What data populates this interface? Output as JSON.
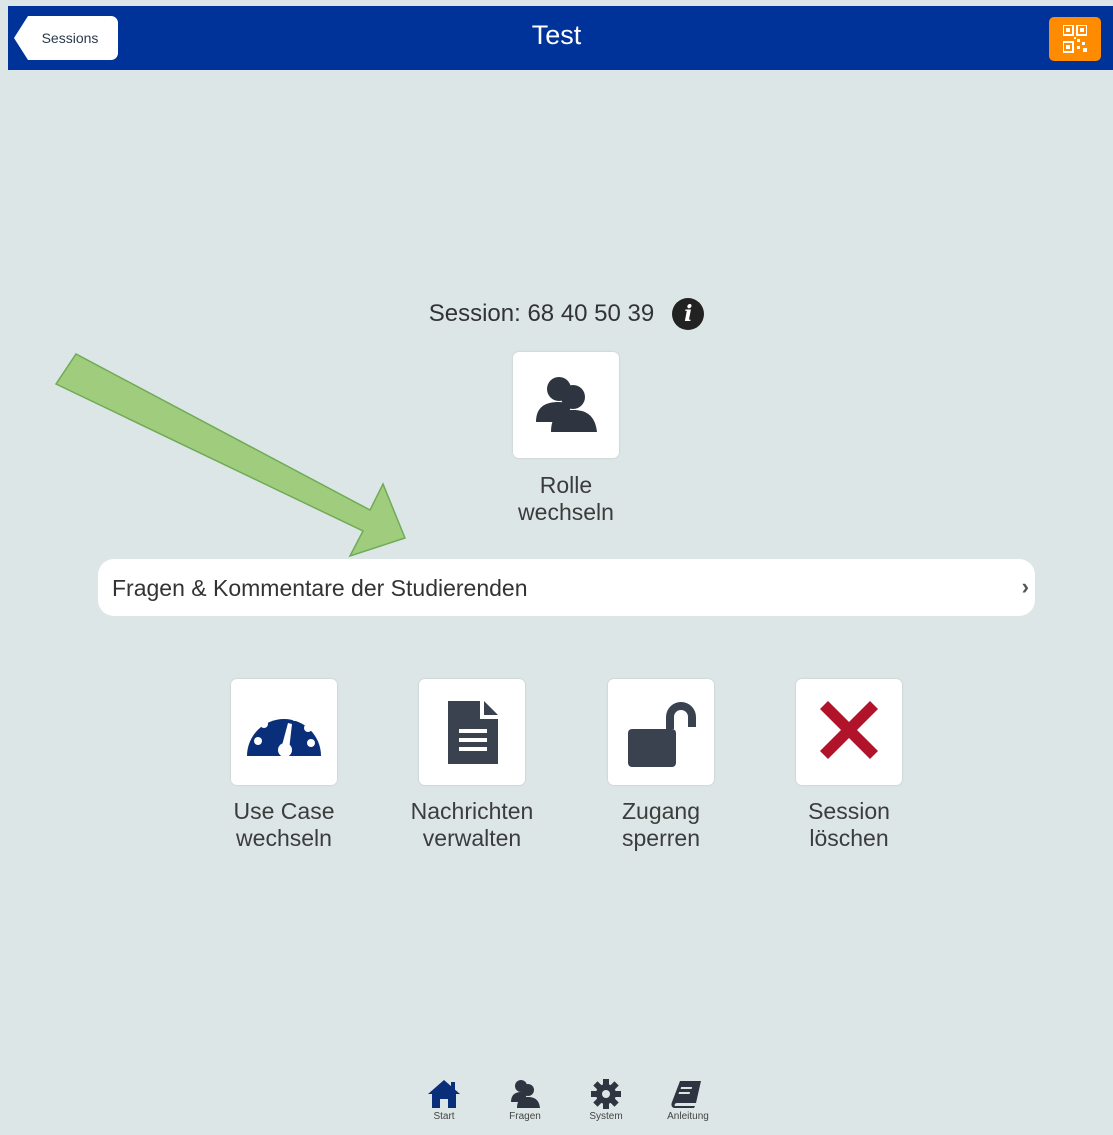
{
  "header": {
    "back_label": "Sessions",
    "title": "Test",
    "qr_icon": "qr-code-icon"
  },
  "session": {
    "text": "Session: 68 40 50 39",
    "info_icon": "info-icon"
  },
  "role_tile": {
    "icon": "users-icon",
    "label": "Rolle\nwechseln"
  },
  "questions_row": {
    "label": "Fragen & Kommentare der Studierenden",
    "chevron": "›"
  },
  "tiles": [
    {
      "icon": "dashboard-icon",
      "label": "Use Case\nwechseln"
    },
    {
      "icon": "document-icon",
      "label": "Nachrichten\nverwalten"
    },
    {
      "icon": "unlock-icon",
      "label": "Zugang\nsperren"
    },
    {
      "icon": "close-icon",
      "label": "Session\nlöschen"
    }
  ],
  "bottom_nav": [
    {
      "icon": "home-icon",
      "label": "Start"
    },
    {
      "icon": "users-icon",
      "label": "Fragen"
    },
    {
      "icon": "gear-icon",
      "label": "System"
    },
    {
      "icon": "book-icon",
      "label": "Anleitung"
    }
  ],
  "colors": {
    "header_bg": "#003399",
    "page_bg": "#dde6e6",
    "qr_button": "#ff8c00",
    "dashboard_icon": "#0a2f7a",
    "icon_dark": "#3a4250",
    "delete_icon": "#b0132a",
    "annotation_arrow": "#9ccc78"
  }
}
